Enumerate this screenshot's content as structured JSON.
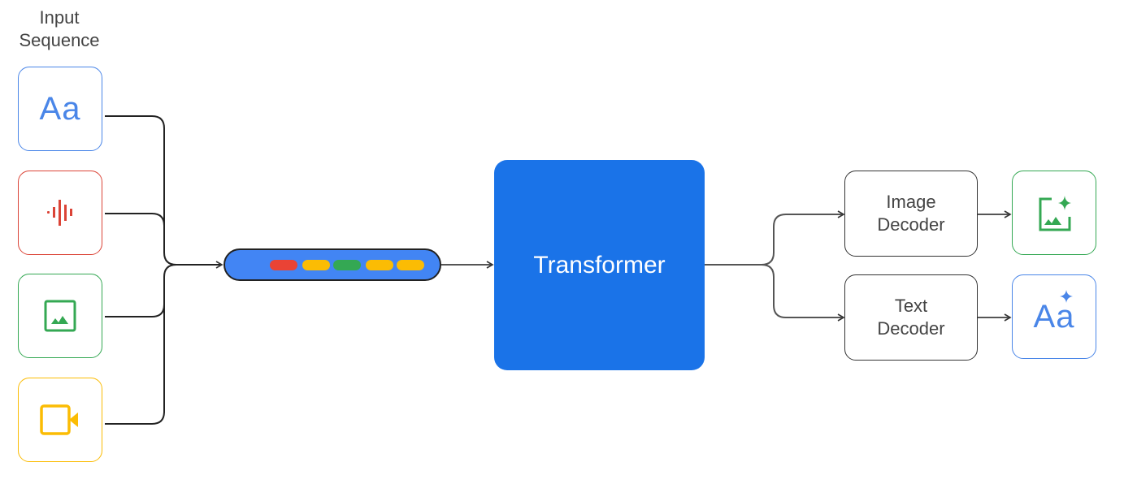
{
  "title": {
    "line1": "Input",
    "line2": "Sequence"
  },
  "colors": {
    "blue": "#4285f4",
    "red": "#ea4335",
    "green": "#34a853",
    "yellow": "#fbbc04",
    "transformer_fill": "#1a73e8",
    "connector": "#222222",
    "text": "#444444"
  },
  "inputs": [
    {
      "modality": "text",
      "icon": "text-aa-icon",
      "glyph": "Aa",
      "color": "#4a86e8"
    },
    {
      "modality": "audio",
      "icon": "audio-waveform-icon",
      "color": "#db4437"
    },
    {
      "modality": "image",
      "icon": "image-icon",
      "color": "#34a853"
    },
    {
      "modality": "video",
      "icon": "video-camera-icon",
      "color": "#fbbc04"
    }
  ],
  "token_sequence": {
    "tokens": [
      "#4285f4",
      "#4285f4",
      "#ea4335",
      "#fbbc04",
      "#34a853",
      "#fbbc04"
    ]
  },
  "transformer": {
    "label": "Transformer"
  },
  "decoders": [
    {
      "line1": "Image",
      "line2": "Decoder"
    },
    {
      "line1": "Text",
      "line2": "Decoder"
    }
  ],
  "outputs": [
    {
      "modality": "generated-image",
      "icon": "image-sparkle-icon",
      "color": "#34a853"
    },
    {
      "modality": "generated-text",
      "icon": "text-sparkle-icon",
      "glyph": "Aa",
      "color": "#4a86e8"
    }
  ]
}
